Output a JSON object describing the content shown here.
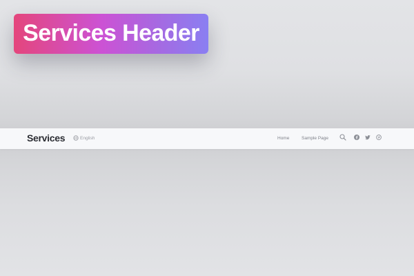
{
  "badge": {
    "title": "Services Header"
  },
  "header": {
    "site_title": "Services",
    "language": {
      "label": "English",
      "icon": "globe-icon"
    },
    "nav": [
      {
        "label": "Home"
      },
      {
        "label": "Sample Page"
      }
    ],
    "icons": [
      "search-icon",
      "facebook-icon",
      "twitter-icon",
      "pinterest-icon"
    ]
  },
  "colors": {
    "badge_gradient_start": "#e4467c",
    "badge_gradient_end": "#8a7ff2",
    "header_bg": "#f7f8fa",
    "page_bg": "#dfe0e3",
    "site_title": "#2b2d33",
    "muted_text": "#9a9ca3"
  }
}
